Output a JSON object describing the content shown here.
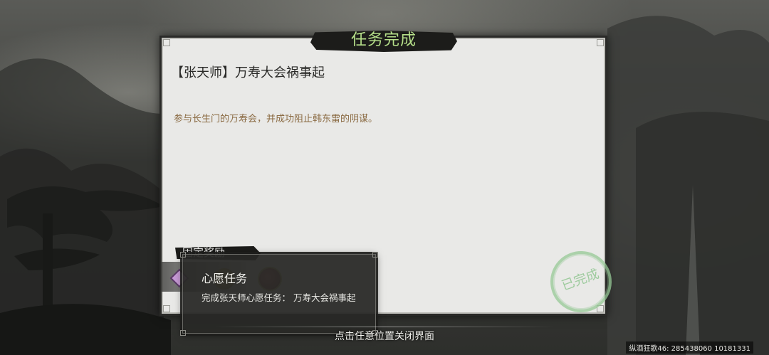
{
  "dialog": {
    "title": "任务完成",
    "quest_name": "【张天师】万寿大会祸事起",
    "description": "参与长生门的万寿会，并成功阻止韩东雷的阴谋。",
    "reward_tag": "固定奖励",
    "stamp_text": "已完成"
  },
  "tooltip": {
    "title": "心愿任务",
    "description": "完成张天师心愿任务：  万寿大会祸事起"
  },
  "close_hint": "点击任意位置关闭界面",
  "server_info": "纵酒狂歌46: 285438060  10181331",
  "icons": [
    "reward-diamond-icon",
    "reward-orb-icon",
    "reward-medal-icon"
  ],
  "colors": {
    "title": "#b6e08a",
    "description": "#8a6a42",
    "stamp": "#96c896"
  }
}
